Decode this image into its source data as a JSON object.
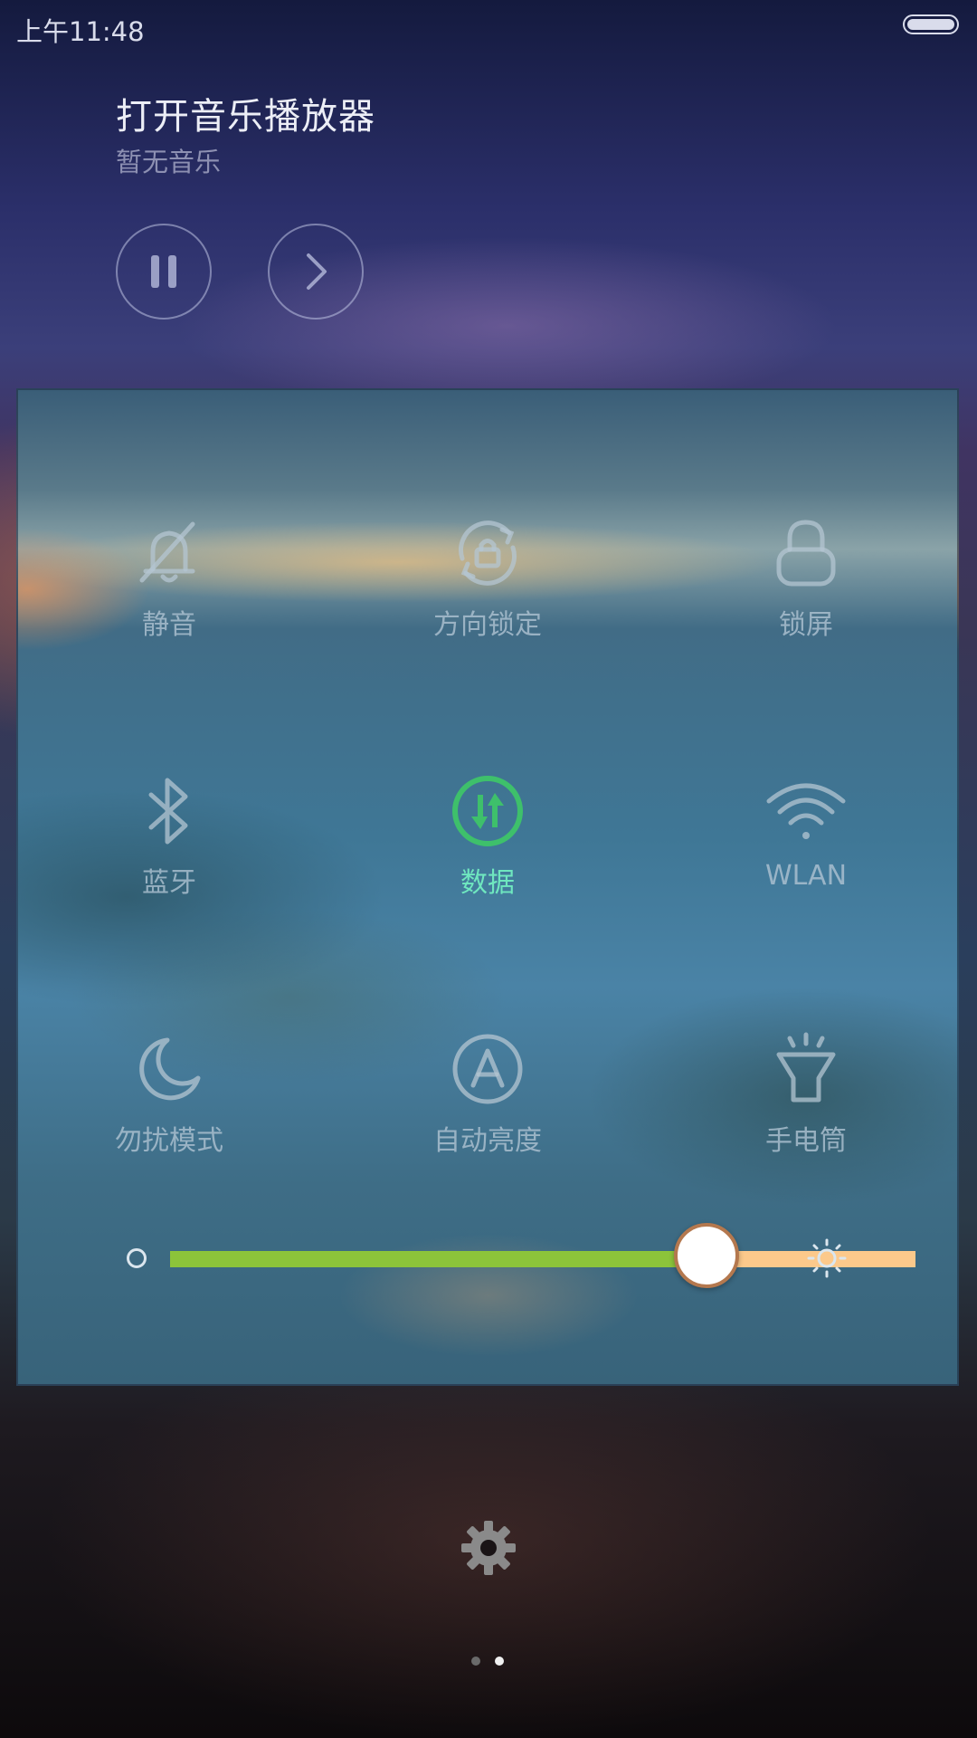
{
  "status_bar": {
    "time": "上午11:48"
  },
  "music": {
    "title": "打开音乐播放器",
    "subtitle": "暂无音乐",
    "controls": {
      "pause_icon": "pause-icon",
      "next_icon": "chevron-right-icon"
    }
  },
  "toggles": [
    {
      "label": "静音",
      "icon": "bell-off-icon",
      "active": false
    },
    {
      "label": "方向锁定",
      "icon": "rotation-lock-icon",
      "active": false
    },
    {
      "label": "锁屏",
      "icon": "lock-icon",
      "active": false
    },
    {
      "label": "蓝牙",
      "icon": "bluetooth-icon",
      "active": false
    },
    {
      "label": "数据",
      "icon": "mobile-data-icon",
      "active": true
    },
    {
      "label": "WLAN",
      "icon": "wifi-icon",
      "active": false
    },
    {
      "label": "勿扰模式",
      "icon": "moon-icon",
      "active": false
    },
    {
      "label": "自动亮度",
      "icon": "auto-brightness-icon",
      "active": false
    },
    {
      "label": "手电筒",
      "icon": "flashlight-icon",
      "active": false
    }
  ],
  "brightness": {
    "level": 0.72,
    "low_color": "#8cc43a",
    "high_color": "#fcc98b"
  },
  "colors": {
    "active": "#3ec06b",
    "active_label": "#6fe7bf",
    "inactive": "#b4c6d2"
  },
  "pager": {
    "count": 2,
    "current": 2
  }
}
